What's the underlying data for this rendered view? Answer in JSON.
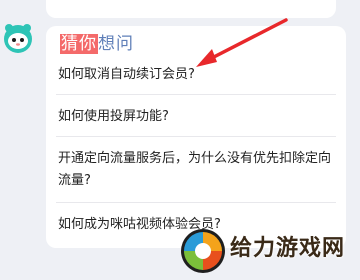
{
  "header": {
    "highlight_text": "猜你",
    "rest_text": "想问"
  },
  "questions": [
    {
      "text": "如何取消自动续订会员?"
    },
    {
      "text": "如何使用投屏功能?"
    },
    {
      "text": "开通定向流量服务后，为什么没有优先扣除定向流量?"
    },
    {
      "text": "如何成为咪咕视频体验会员?"
    }
  ],
  "watermark": {
    "text": "给力游戏网"
  },
  "colors": {
    "highlight_bg": "#f46a6a",
    "title_blue": "#5f7fb8",
    "arrow_red": "#e8282b",
    "page_bg": "#eef0f5"
  }
}
